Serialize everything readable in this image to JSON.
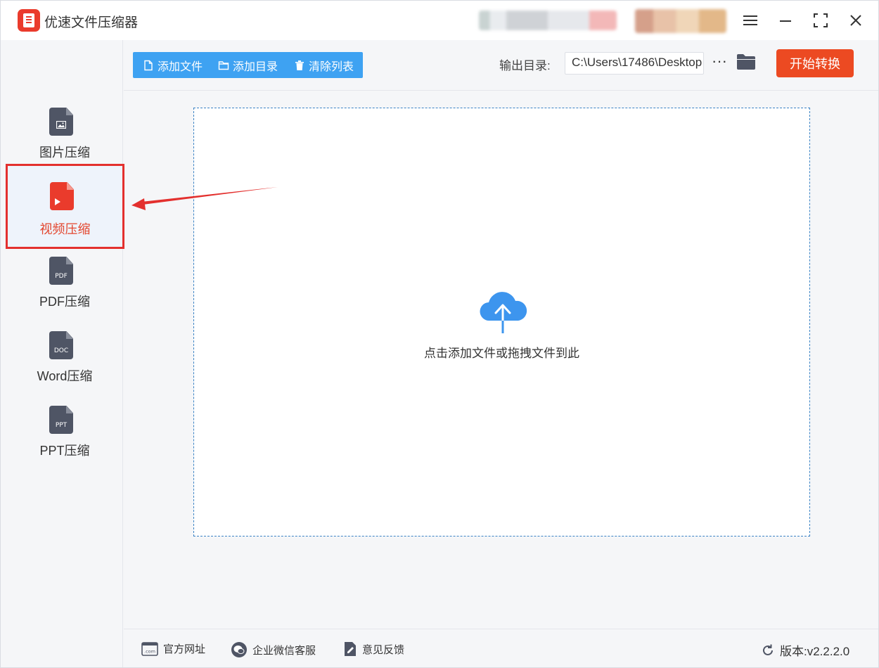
{
  "app": {
    "title": "优速文件压缩器"
  },
  "sidebar": {
    "items": [
      {
        "label": "图片压缩",
        "icon": "image-file-icon",
        "active": false
      },
      {
        "label": "视频压缩",
        "icon": "video-file-icon",
        "active": true,
        "tag": ""
      },
      {
        "label": "PDF压缩",
        "icon": "pdf-file-icon",
        "active": false,
        "tag": "PDF"
      },
      {
        "label": "Word压缩",
        "icon": "doc-file-icon",
        "active": false,
        "tag": "DOC"
      },
      {
        "label": "PPT压缩",
        "icon": "ppt-file-icon",
        "active": false,
        "tag": "PPT"
      }
    ]
  },
  "toolbar": {
    "add_file": "添加文件",
    "add_dir": "添加目录",
    "clear_list": "清除列表",
    "output_label": "输出目录:",
    "output_path": "C:\\Users\\17486\\Desktop",
    "more": "···",
    "start": "开始转换"
  },
  "dropzone": {
    "hint": "点击添加文件或拖拽文件到此"
  },
  "footer": {
    "site": "官方网址",
    "site_icon_text": ".com",
    "wechat": "企业微信客服",
    "feedback": "意见反馈",
    "version": "版本:v2.2.2.0"
  },
  "colors": {
    "accent_blue": "#3ea2f2",
    "start_orange": "#ec4a22",
    "highlight_red": "#e3302e",
    "icon_gray": "#4f5565"
  }
}
